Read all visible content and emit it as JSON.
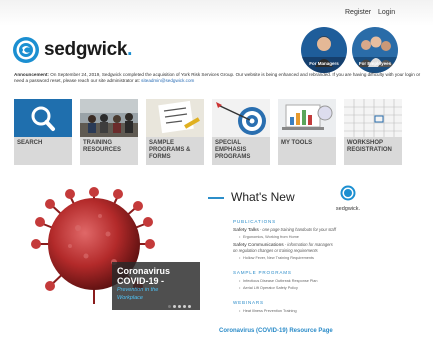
{
  "header": {
    "register": "Register",
    "login": "Login"
  },
  "brand": {
    "name": "sedgwick",
    "dot": "."
  },
  "audience": {
    "managers": "For Managers",
    "employees": "For Employees"
  },
  "announcement": {
    "label": "Announcement:",
    "text": " On September 24, 2019, Sedgwick completed the acquisition of York Risk Services Group. Our website is being enhanced and rebranded. If you are having difficulty with your login or need a password reset, please reach our site administrator at: ",
    "email": "siteadmin@sedgwick.com"
  },
  "tiles": [
    {
      "label": "SEARCH",
      "icon": "search-icon"
    },
    {
      "label": "TRAINING RESOURCES",
      "icon": "classroom-photo"
    },
    {
      "label": "SAMPLE PROGRAMS & FORMS",
      "icon": "safety-note-photo"
    },
    {
      "label": "SPECIAL EMPHASIS PROGRAMS",
      "icon": "target-photo"
    },
    {
      "label": "MY TOOLS",
      "icon": "laptop-chart-photo"
    },
    {
      "label": "WORKSHOP REGISTRATION",
      "icon": "calendar-photo"
    }
  ],
  "hero": {
    "title_line1": "Coronavirus",
    "title_line2": "COVID-19 -",
    "subtitle_line1": "Prevention in the",
    "subtitle_line2": "Workplace",
    "slide_count": 5,
    "active_slide": 0
  },
  "whats_new": {
    "title": "What's New",
    "logo_word": "sedgwick.",
    "publications_heading": "PUBLICATIONS",
    "pub1_title": "Safety Talks",
    "pub1_desc": " - one page training handouts for your staff",
    "pub1_sub": "Ergonomics, Working from Home",
    "pub2_title": "Safety Communications",
    "pub2_desc": " - information for managers",
    "pub2_desc2": "on regulation changes or training requirements",
    "pub2_sub": "Hollow Fever, New Training Requirements",
    "sample_heading": "SAMPLE PROGRAMS",
    "sample1": "Infectious Disease Outbreak Response Plan",
    "sample2": "Aerial Lift Operator Safety Policy",
    "webinars_heading": "WEBINARS",
    "webinar1": "Heat Illness Prevention Training"
  },
  "resource_link": "Coronavirus (COVID-19) Resource Page",
  "colors": {
    "brand_blue": "#1b8fd1",
    "link_blue": "#2a8bc8",
    "tile_bg": "#d9d9d9",
    "search_tile": "#1f6fae",
    "virus_red": "#b32a2a"
  }
}
